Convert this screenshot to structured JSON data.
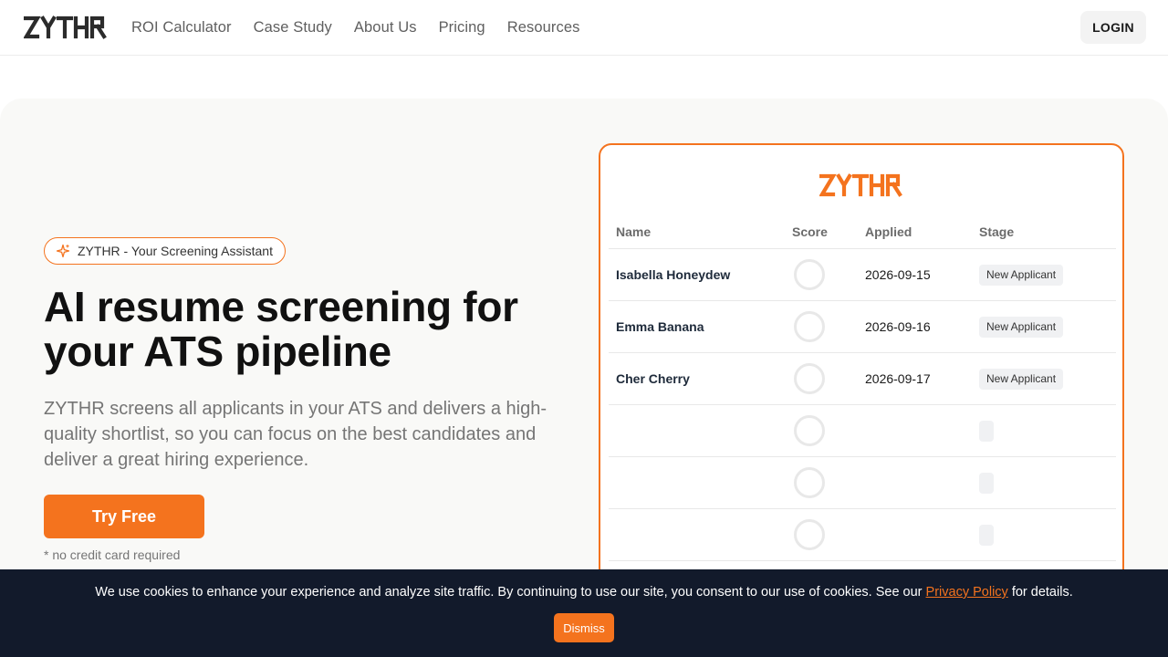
{
  "brand": {
    "logo_text": "ZYTHR",
    "accent_color": "#f4731e",
    "logo_dark_color": "#2b2b2b"
  },
  "nav": {
    "links": [
      "ROI Calculator",
      "Case Study",
      "About Us",
      "Pricing",
      "Resources"
    ],
    "login_label": "LOGIN"
  },
  "hero": {
    "badge_icon": "sparkle-icon",
    "badge_text": "ZYTHR - Your Screening Assistant",
    "headline": "AI resume screening for your ATS pipeline",
    "subtext": "ZYTHR screens all applicants in your ATS and delivers a high-quality shortlist, so you can focus on the best candidates and deliver a great hiring experience.",
    "cta_label": "Try Free",
    "cta_note": "* no credit card required"
  },
  "preview": {
    "columns": [
      "Name",
      "Score",
      "Applied",
      "Stage"
    ],
    "rows": [
      {
        "name": "Isabella Honeydew",
        "applied": "2026-09-15",
        "stage": "New Applicant"
      },
      {
        "name": "Emma Banana",
        "applied": "2026-09-16",
        "stage": "New Applicant"
      },
      {
        "name": "Cher Cherry",
        "applied": "2026-09-17",
        "stage": "New Applicant"
      },
      {
        "name": "",
        "applied": "",
        "stage": ""
      },
      {
        "name": "",
        "applied": "",
        "stage": ""
      },
      {
        "name": "",
        "applied": "",
        "stage": ""
      }
    ]
  },
  "cookie": {
    "text_before": "We use cookies to enhance your experience and analyze site traffic. By continuing to use our site, you consent to our use of cookies. See our ",
    "link_text": "Privacy Policy",
    "text_after": " for details.",
    "dismiss_label": "Dismiss"
  }
}
